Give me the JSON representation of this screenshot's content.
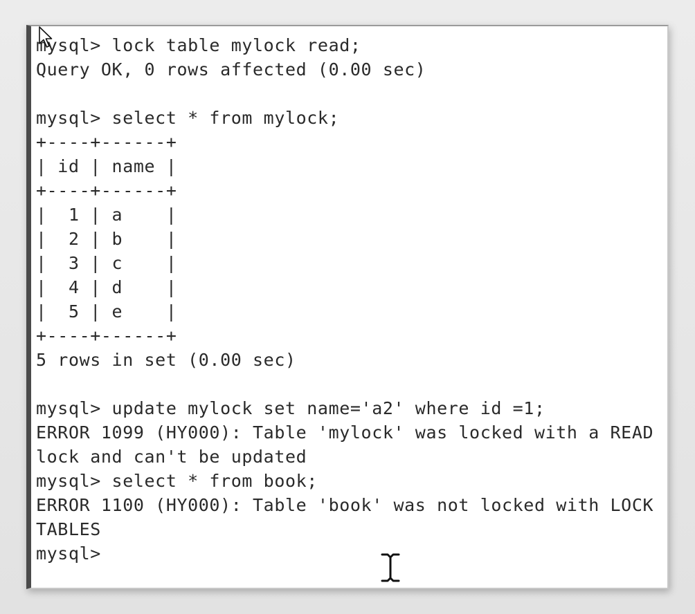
{
  "terminal": {
    "lines": [
      "mysql> lock table mylock read;",
      "Query OK, 0 rows affected (0.00 sec)",
      "",
      "mysql> select * from mylock;",
      "+----+------+",
      "| id | name |",
      "+----+------+",
      "|  1 | a    |",
      "|  2 | b    |",
      "|  3 | c    |",
      "|  4 | d    |",
      "|  5 | e    |",
      "+----+------+",
      "5 rows in set (0.00 sec)",
      "",
      "mysql> update mylock set name='a2' where id =1;",
      "ERROR 1099 (HY000): Table 'mylock' was locked with a READ",
      "lock and can't be updated",
      "mysql> select * from book;",
      "ERROR 1100 (HY000): Table 'book' was not locked with LOCK",
      "TABLES",
      "mysql>"
    ]
  },
  "icons": {
    "mouse_pointer": "arrow-pointer-icon",
    "text_cursor": "i-beam-cursor-icon"
  },
  "colors": {
    "background": "#ffffff",
    "text": "#2a2a2a",
    "window_left_border": "#4a4a4a"
  }
}
